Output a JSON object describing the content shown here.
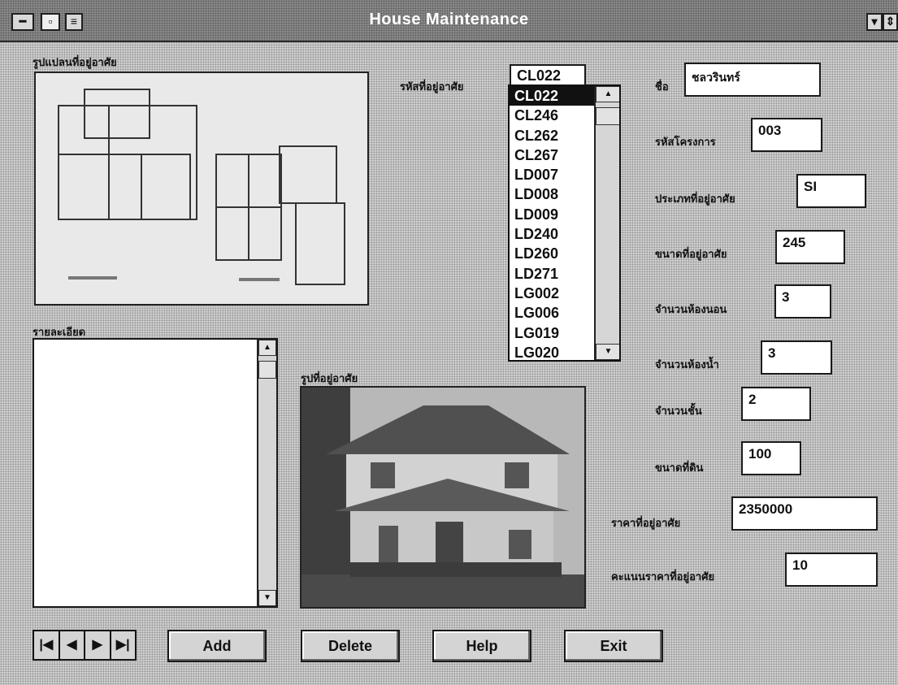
{
  "window": {
    "title": "House Maintenance",
    "control_icon": "system-menu-icon",
    "min_glyph": "▾",
    "max_glyph": "⇕"
  },
  "labels": {
    "floor_plan": "รูปแปลนที่อยู่อาศัย",
    "house_code": "รหัสที่อยู่อาศัย",
    "name": "ชื่อ",
    "project_code": "รหัสโครงการ",
    "house_type": "ประเภทที่อยู่อาศัย",
    "house_size": "ขนาดที่อยู่อาศัย",
    "bedrooms": "จำนวนห้องนอน",
    "bathrooms": "จำนวนห้องน้ำ",
    "floors": "จำนวนชั้น",
    "land_size": "ขนาดที่ดิน",
    "price": "ราคาที่อยู่อาศัย",
    "price_score": "คะแนนราคาที่อยู่อาศัย",
    "details": "รายละเอียด",
    "house_photo": "รูปที่อยู่อาศัย"
  },
  "fields": {
    "house_code": "CL022",
    "name": "ชลวรินทร์",
    "project_code": "003",
    "house_type": "SI",
    "house_size": "245",
    "bedrooms": "3",
    "bathrooms": "3",
    "floors": "2",
    "land_size": "100",
    "price": "2350000",
    "price_score": "10",
    "details": ""
  },
  "house_list": {
    "items": [
      "CL022",
      "CL246",
      "CL262",
      "CL267",
      "LD007",
      "LD008",
      "LD009",
      "LD240",
      "LD260",
      "LD271",
      "LG002",
      "LG006",
      "LG019",
      "LG020"
    ],
    "selected": "CL022"
  },
  "nav": {
    "first": "|◀",
    "prev": "◀",
    "next": "▶",
    "last": "▶|"
  },
  "buttons": {
    "add": "Add",
    "delete": "Delete",
    "help": "Help",
    "exit": "Exit"
  }
}
